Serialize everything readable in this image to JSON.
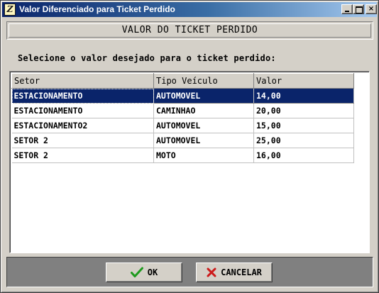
{
  "window": {
    "title": "Valor Diferenciado para Ticket Perdido",
    "icon_glyph": "Z",
    "title_icon": "app-logo-icon",
    "controls": {
      "minimize": "minimize-icon",
      "maximize": "maximize-icon",
      "close": "×"
    }
  },
  "header": {
    "title": "VALOR DO TICKET PERDIDO"
  },
  "prompt": "Selecione o valor desejado para o ticket perdido:",
  "grid": {
    "columns": [
      "Setor",
      "Tipo Veículo",
      "Valor"
    ],
    "rows": [
      [
        "ESTACIONAMENTO",
        "AUTOMOVEL",
        "14,00"
      ],
      [
        "ESTACIONAMENTO",
        "CAMINHAO",
        "20,00"
      ],
      [
        "ESTACIONAMENTO2",
        "AUTOMOVEL",
        "15,00"
      ],
      [
        "SETOR 2",
        "AUTOMOVEL",
        "25,00"
      ],
      [
        "SETOR 2",
        "MOTO",
        "16,00"
      ]
    ],
    "selected_row": 0
  },
  "buttons": {
    "ok_label": "OK",
    "ok_icon": "checkmark-icon",
    "cancel_label": "CANCELAR",
    "cancel_icon": "x-mark-icon"
  },
  "colors": {
    "selection": "#0a246a",
    "ok_icon": "#1e9a1e",
    "cancel_icon": "#cc1a1a",
    "face": "#d4d0c8"
  }
}
